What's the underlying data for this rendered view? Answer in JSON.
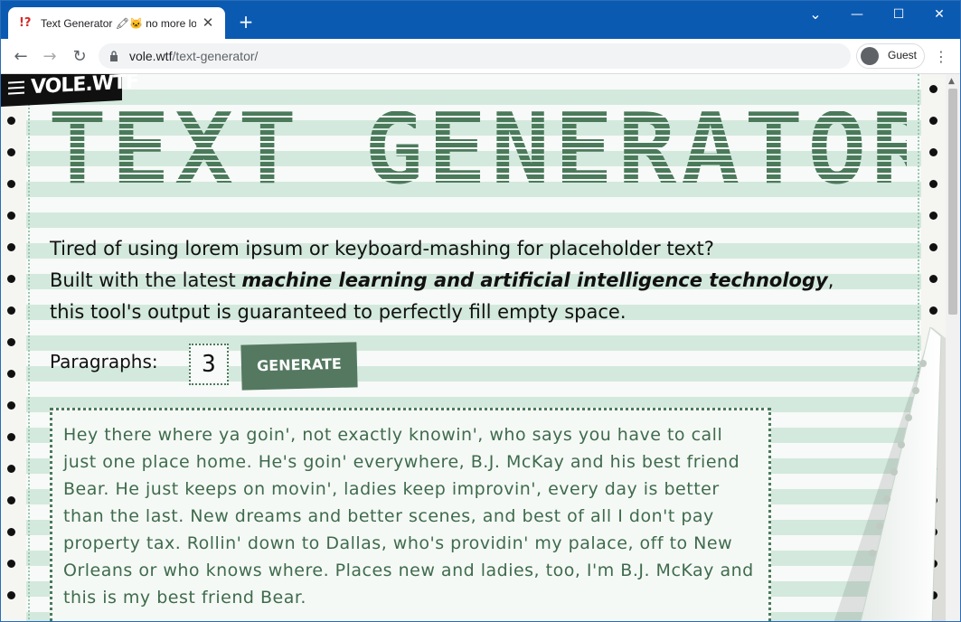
{
  "browser": {
    "tab_title": "Text Generator 🖍🐱 no more lo",
    "favicon_text": "!?",
    "new_tab": "+",
    "url_host": "vole.wtf",
    "url_path": "/text-generator/",
    "profile_name": "Guest",
    "controls": {
      "minimize": "—",
      "maximize": "☐",
      "close": "✕",
      "dropdown": "⌄"
    }
  },
  "site": {
    "logo": "VOLE.WTF",
    "title": "TEXT GENERATOR",
    "intro": {
      "line1": "Tired of using lorem ipsum or keyboard-mashing for placeholder text?",
      "line2_pre": "Built with the latest ",
      "line2_em": "machine learning and artificial intelligence technology",
      "line2_post": ",",
      "line3": "this tool's output is guaranteed to perfectly fill empty space."
    },
    "paragraphs_label": "Paragraphs:",
    "paragraphs_value": "3",
    "generate_label": "GENERATE",
    "output_text": "Hey there where ya goin', not exactly knowin', who says you have to call just one place home. He's goin' everywhere, B.J. McKay and his best friend Bear. He just keeps on movin', ladies keep improvin', every day is better than the last. New dreams and better scenes, and best of all I don't pay property tax. Rollin' down to Dallas, who's providin' my palace, off to New Orleans or who knows where. Places new and ladies, too, I'm B.J. McKay and this is my best friend Bear."
  },
  "colors": {
    "accent": "#547960",
    "stripe": "#d4e9dd",
    "titlebar": "#0b5ab2"
  }
}
